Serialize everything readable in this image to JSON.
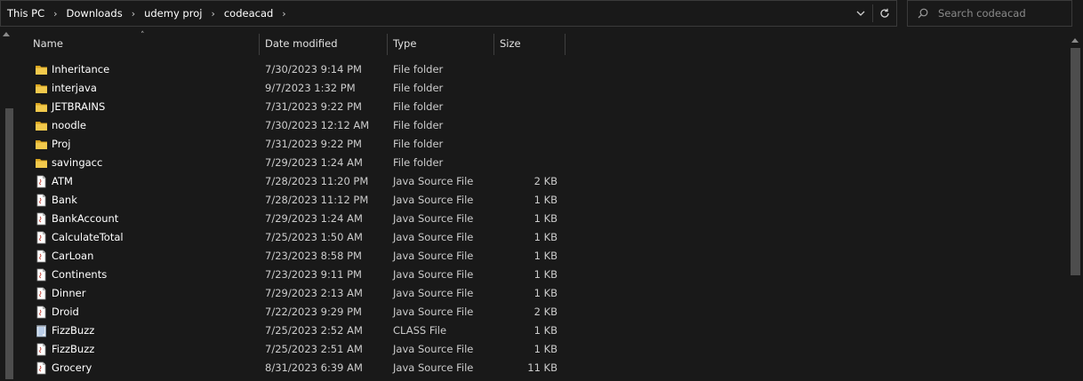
{
  "breadcrumb": [
    "This PC",
    "Downloads",
    "udemy proj",
    "codeacad"
  ],
  "search": {
    "placeholder": "Search codeacad"
  },
  "columns": {
    "name": "Name",
    "date": "Date modified",
    "type": "Type",
    "size": "Size"
  },
  "colors": {
    "folder": "#f2c94c",
    "folder_dark": "#d9a520",
    "file_bg": "#ffffff",
    "java_mark": "#c0392b"
  },
  "files": [
    {
      "icon": "folder-icon",
      "name": "Inheritance",
      "date": "7/30/2023 9:14 PM",
      "type": "File folder",
      "size": ""
    },
    {
      "icon": "folder-icon",
      "name": "interjava",
      "date": "9/7/2023 1:32 PM",
      "type": "File folder",
      "size": ""
    },
    {
      "icon": "folder-icon",
      "name": "JETBRAINS",
      "date": "7/31/2023 9:22 PM",
      "type": "File folder",
      "size": ""
    },
    {
      "icon": "folder-icon",
      "name": "noodle",
      "date": "7/30/2023 12:12 AM",
      "type": "File folder",
      "size": ""
    },
    {
      "icon": "folder-icon",
      "name": "Proj",
      "date": "7/31/2023 9:22 PM",
      "type": "File folder",
      "size": ""
    },
    {
      "icon": "folder-icon",
      "name": "savingacc",
      "date": "7/29/2023 1:24 AM",
      "type": "File folder",
      "size": ""
    },
    {
      "icon": "java-file-icon",
      "name": "ATM",
      "date": "7/28/2023 11:20 PM",
      "type": "Java Source File",
      "size": "2 KB"
    },
    {
      "icon": "java-file-icon",
      "name": "Bank",
      "date": "7/28/2023 11:12 PM",
      "type": "Java Source File",
      "size": "1 KB"
    },
    {
      "icon": "java-file-icon",
      "name": "BankAccount",
      "date": "7/29/2023 1:24 AM",
      "type": "Java Source File",
      "size": "1 KB"
    },
    {
      "icon": "java-file-icon",
      "name": "CalculateTotal",
      "date": "7/25/2023 1:50 AM",
      "type": "Java Source File",
      "size": "1 KB"
    },
    {
      "icon": "java-file-icon",
      "name": "CarLoan",
      "date": "7/23/2023 8:58 PM",
      "type": "Java Source File",
      "size": "1 KB"
    },
    {
      "icon": "java-file-icon",
      "name": "Continents",
      "date": "7/23/2023 9:11 PM",
      "type": "Java Source File",
      "size": "1 KB"
    },
    {
      "icon": "java-file-icon",
      "name": "Dinner",
      "date": "7/29/2023 2:13 AM",
      "type": "Java Source File",
      "size": "1 KB"
    },
    {
      "icon": "java-file-icon",
      "name": "Droid",
      "date": "7/22/2023 9:29 PM",
      "type": "Java Source File",
      "size": "2 KB"
    },
    {
      "icon": "class-file-icon",
      "name": "FizzBuzz",
      "date": "7/25/2023 2:52 AM",
      "type": "CLASS File",
      "size": "1 KB"
    },
    {
      "icon": "java-file-icon",
      "name": "FizzBuzz",
      "date": "7/25/2023 2:51 AM",
      "type": "Java Source File",
      "size": "1 KB"
    },
    {
      "icon": "java-file-icon",
      "name": "Grocery",
      "date": "8/31/2023 6:39 AM",
      "type": "Java Source File",
      "size": "11 KB"
    }
  ]
}
